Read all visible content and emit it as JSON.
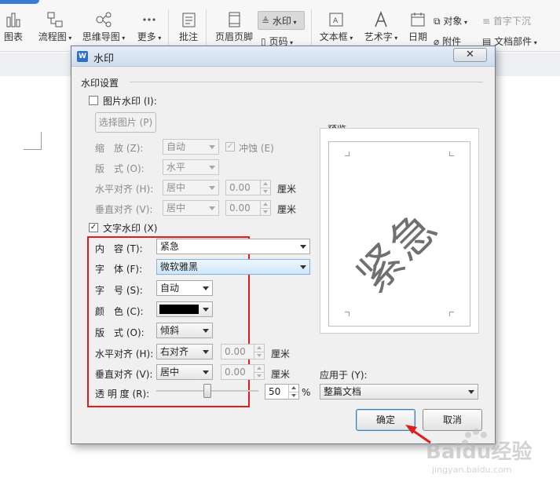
{
  "ribbon": {
    "items": {
      "chart": "图表",
      "flowchart": "流程图",
      "mindmap": "思维导图",
      "more": "更多",
      "annotation": "批注",
      "header_footer": "页眉页脚",
      "watermark": "水印",
      "page_number": "页码",
      "textbox": "文本框",
      "wordart": "艺术字",
      "date": "日期",
      "object": "对象",
      "dropcap": "首字下沉",
      "attachment": "附件",
      "doc_parts": "文档部件"
    }
  },
  "dialog": {
    "title": "水印",
    "group_label": "水印设置",
    "picture_watermark": {
      "checkbox_label": "图片水印 (I):",
      "checked": false,
      "select_button": "选择图片 (P)",
      "scale_label": "缩　放 (Z):",
      "scale_value": "自动",
      "washout_label": "冲蚀 (E)",
      "layout_label": "版　式 (O):",
      "layout_value": "水平",
      "halign_label": "水平对齐 (H):",
      "halign_value": "居中",
      "halign_offset": "0.00",
      "valign_label": "垂直对齐 (V):",
      "valign_value": "居中",
      "valign_offset": "0.00",
      "unit": "厘米"
    },
    "text_watermark": {
      "checkbox_label": "文字水印 (X)",
      "checked": true,
      "content_label": "内　容 (T):",
      "content_value": "紧急",
      "font_label": "字　体 (F):",
      "font_value": "微软雅黑",
      "size_label": "字　号 (S):",
      "size_value": "自动",
      "color_label": "颜　色 (C):",
      "color_value": "#000000",
      "layout_label": "版　式 (O):",
      "layout_value": "倾斜",
      "halign_label": "水平对齐 (H):",
      "halign_value": "右对齐",
      "halign_offset": "0.00",
      "valign_label": "垂直对齐 (V):",
      "valign_value": "居中",
      "valign_offset": "0.00",
      "unit": "厘米",
      "transparency_label": "透 明 度 (R):",
      "transparency_value": "50",
      "transparency_unit": "%",
      "transparency_level": 0.5
    },
    "preview": {
      "label": "预览",
      "watermark_text": "紧急"
    },
    "apply_to": {
      "label": "应用于 (Y):",
      "value": "整篇文档"
    },
    "buttons": {
      "ok": "确定",
      "cancel": "取消"
    }
  },
  "watermark_logo": {
    "brand": "Baidu经验",
    "url": "jingyan.baidu.com"
  },
  "colors": {
    "highlight_box": "#e01c1c",
    "arrow": "#e01c1c"
  }
}
